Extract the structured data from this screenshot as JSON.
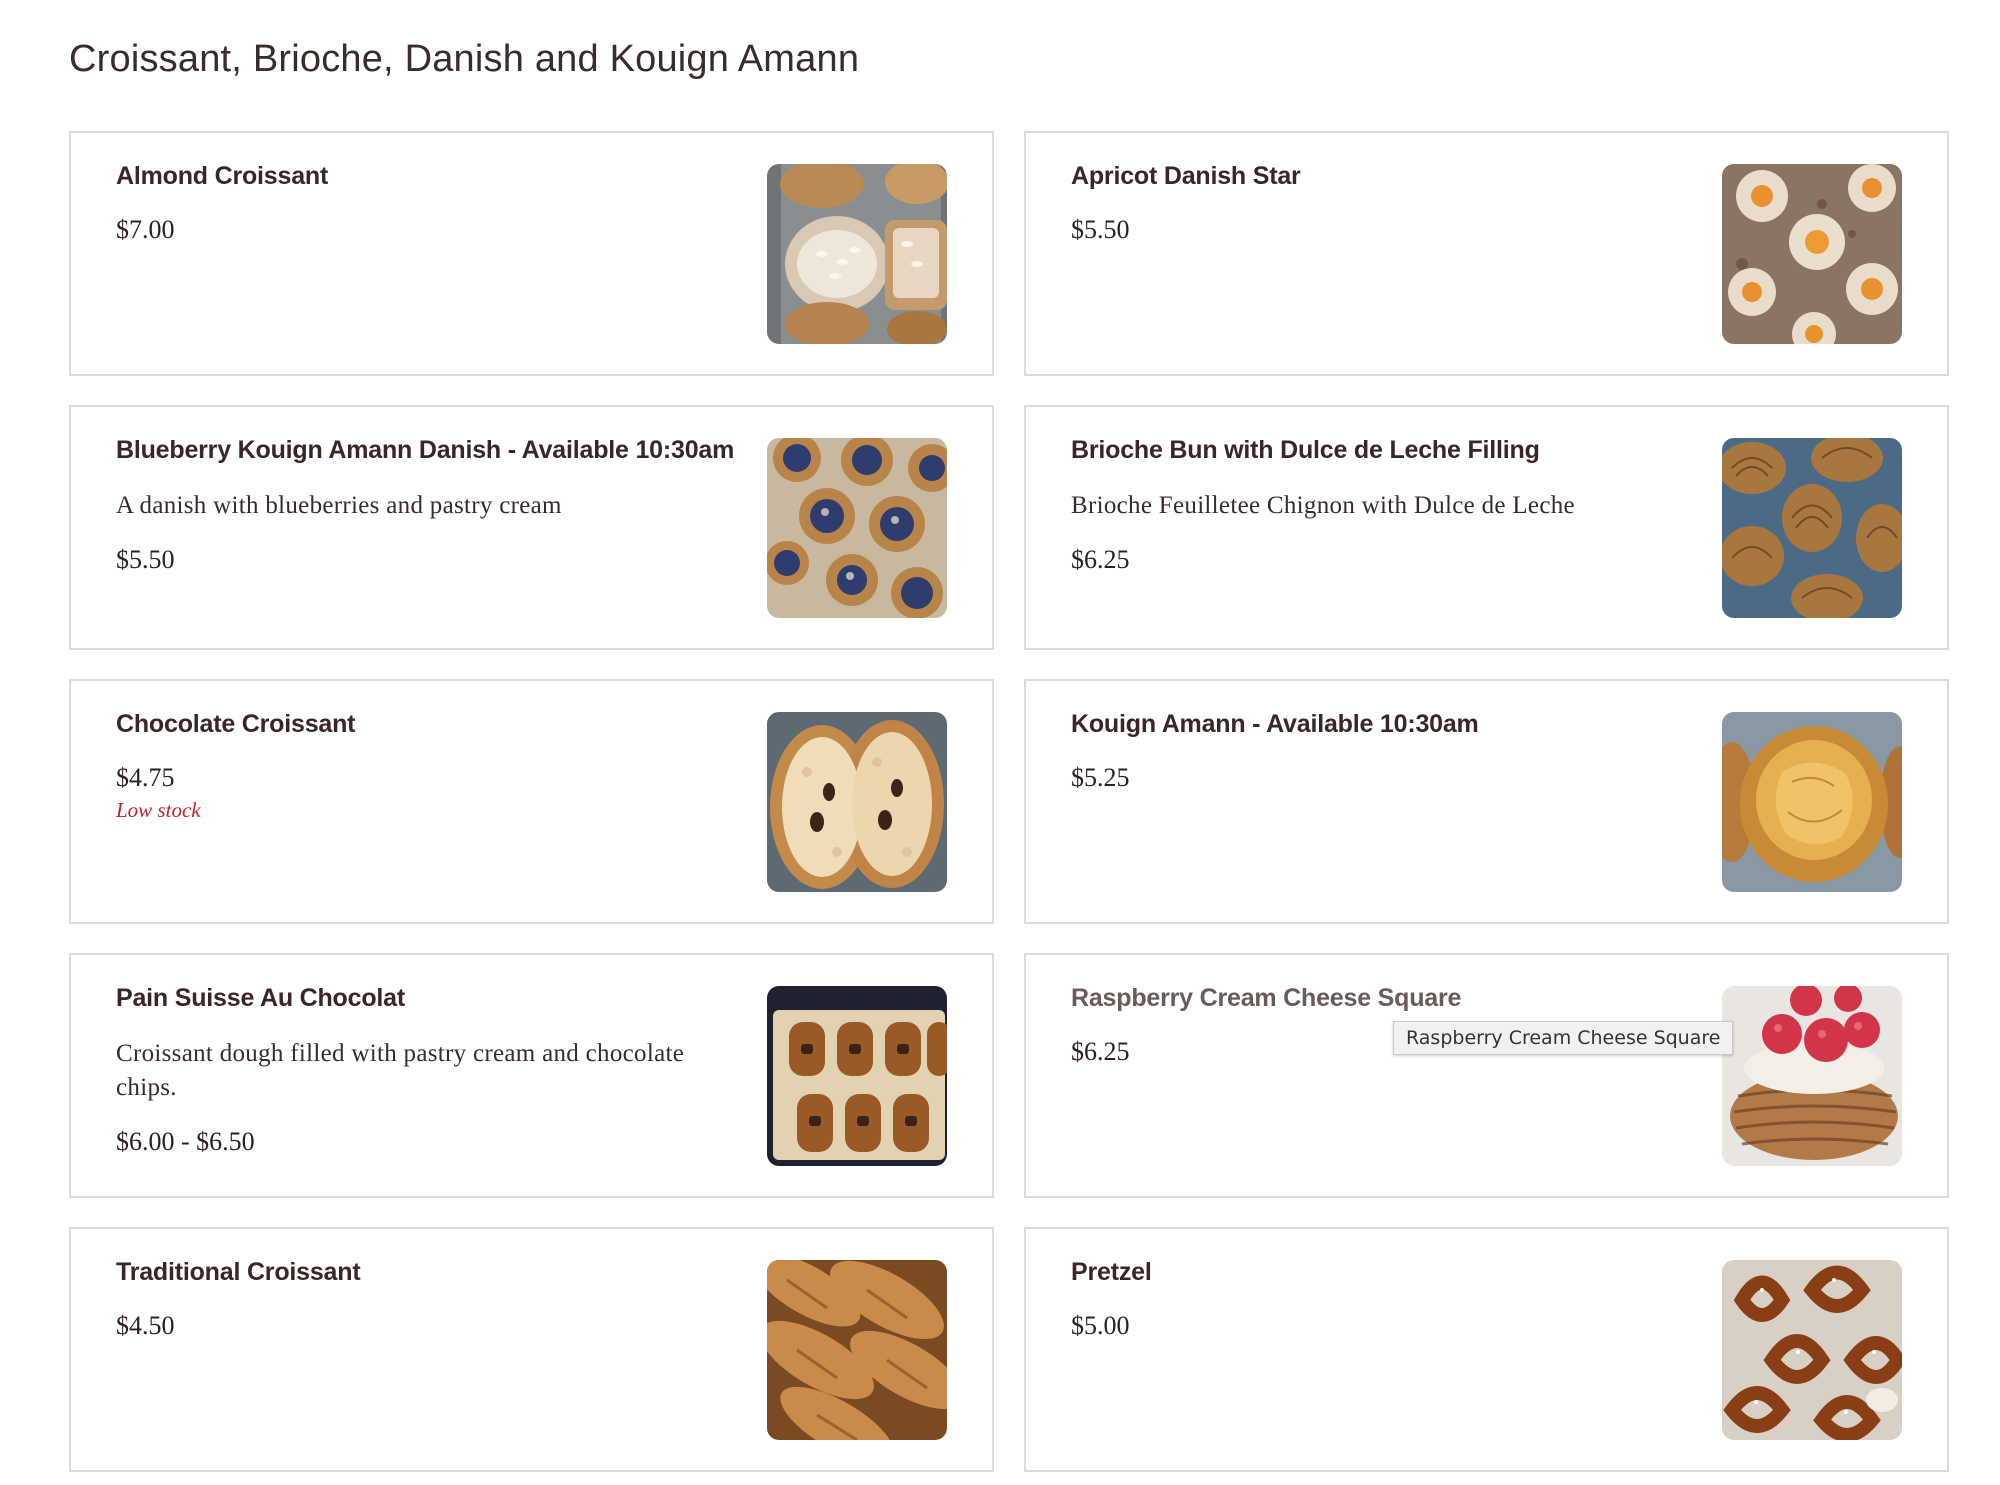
{
  "section": {
    "title": "Croissant, Brioche, Danish and Kouign Amann"
  },
  "items": [
    {
      "name": "Almond Croissant",
      "description": "",
      "price": "$7.00",
      "stock": "",
      "image_icon": "almond-croissant-photo"
    },
    {
      "name": "Apricot Danish Star",
      "description": "",
      "price": "$5.50",
      "stock": "",
      "image_icon": "apricot-danish-photo"
    },
    {
      "name": "Blueberry Kouign Amann Danish - Available 10:30am",
      "description": "A danish with blueberries and pastry cream",
      "price": "$5.50",
      "stock": "",
      "image_icon": "blueberry-danish-photo"
    },
    {
      "name": "Brioche Bun with Dulce de Leche Filling",
      "description": "Brioche Feuilletee Chignon with Dulce de Leche",
      "price": "$6.25",
      "stock": "",
      "image_icon": "brioche-bun-photo"
    },
    {
      "name": "Chocolate Croissant",
      "description": "",
      "price": "$4.75",
      "stock": "Low stock",
      "image_icon": "chocolate-croissant-photo"
    },
    {
      "name": "Kouign Amann - Available 10:30am",
      "description": "",
      "price": "$5.25",
      "stock": "",
      "image_icon": "kouign-amann-photo"
    },
    {
      "name": "Pain Suisse Au Chocolat",
      "description": "Croissant dough filled with pastry cream and chocolate chips.",
      "price": "$6.00 - $6.50",
      "stock": "",
      "image_icon": "pain-suisse-photo"
    },
    {
      "name": "Raspberry Cream Cheese Square",
      "description": "",
      "price": "$6.25",
      "stock": "",
      "image_icon": "raspberry-square-photo"
    },
    {
      "name": "Traditional Croissant",
      "description": "",
      "price": "$4.50",
      "stock": "",
      "image_icon": "traditional-croissant-photo"
    },
    {
      "name": "Pretzel",
      "description": "",
      "price": "$5.00",
      "stock": "",
      "image_icon": "pretzel-photo"
    }
  ],
  "tooltip": {
    "text": "Raspberry Cream Cheese Square"
  },
  "colors": {
    "title": "#3b2b2b",
    "item_name": "#3b2525",
    "low_stock": "#c0242c",
    "card_border": "#dcdcdc"
  }
}
